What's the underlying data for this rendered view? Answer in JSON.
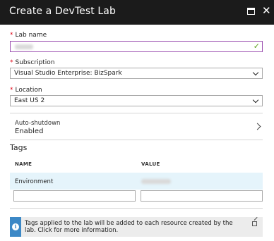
{
  "window": {
    "title": "Create a DevTest Lab"
  },
  "form": {
    "lab_name": {
      "label": "Lab name",
      "required": true,
      "value": ""
    },
    "subscription": {
      "label": "Subscription",
      "required": true,
      "value": "Visual Studio Enterprise: BizSpark"
    },
    "location": {
      "label": "Location",
      "required": true,
      "value": "East US 2"
    },
    "auto_shutdown": {
      "label": "Auto-shutdown",
      "value": "Enabled"
    }
  },
  "tags": {
    "title": "Tags",
    "columns": [
      "NAME",
      "VALUE"
    ],
    "rows": [
      {
        "name": "Environment",
        "value": ""
      }
    ],
    "new_name": "",
    "new_value": ""
  },
  "info": {
    "text": "Tags applied to the lab will be added to each resource created by the lab.  Click for more information."
  },
  "colors": {
    "titlebar": "#1b1b1b",
    "accent": "#9b4fb0",
    "required": "#e00b1c",
    "info": "#3c88c6"
  }
}
